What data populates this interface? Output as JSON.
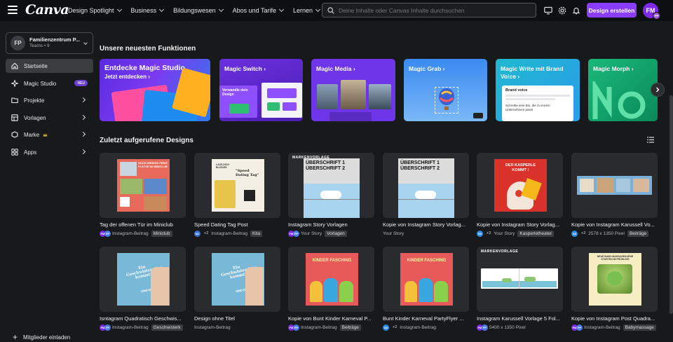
{
  "topbar": {
    "logo": "Canva",
    "nav": [
      "Design Spotlight",
      "Business",
      "Bildungswesen",
      "Abos und Tarife",
      "Lernen"
    ],
    "search_placeholder": "Deine Inhalte oder Canvas Inhalte durchsuchen",
    "create_label": "Design erstellen",
    "avatar_initials": "FM",
    "avatar_mini": "FP"
  },
  "sidebar": {
    "team_initials": "FP",
    "team_name": "Familienzentrum P...",
    "team_meta": "Teams • 9",
    "items": [
      {
        "label": "Startseite"
      },
      {
        "label": "Magic Studio",
        "badge": "NEU"
      },
      {
        "label": "Projekte"
      },
      {
        "label": "Vorlagen"
      },
      {
        "label": "Marke"
      },
      {
        "label": "Apps"
      }
    ],
    "invite_label": "Mitglieder einladen"
  },
  "features": {
    "heading": "Unsere neuesten Funktionen",
    "cards": [
      {
        "label": "Entdecke Magic Studio",
        "sub": "Jetzt entdecken"
      },
      {
        "label": "Magic Switch"
      },
      {
        "label": "Magic Media"
      },
      {
        "label": "Magic Grab"
      },
      {
        "label": "Magic Write mit Brand Voice"
      },
      {
        "label": "Magic Morph"
      }
    ],
    "switch_inner": "Verwandle dein Design",
    "brand_voice_title": "Brand voice",
    "brand_voice_text": "Schreibe eine Bio, die zu eurem Unternehmen passt"
  },
  "recent": {
    "heading": "Zuletzt aufgerufene Designs",
    "template_badge": "MARKENVORLAGE",
    "designs": [
      {
        "title": "Tag der offenen Tür im Miniclub",
        "people": [
          "FM",
          "FP"
        ],
        "extra": "",
        "type": "Instagram-Beitrag",
        "tag": "Miniclub"
      },
      {
        "title": "Speed Dating Tag Post",
        "people": [
          "MJ"
        ],
        "extra": "+2",
        "type": "Instagram-Beitrag",
        "tag": "Kita"
      },
      {
        "title": "Instagram Story Vorlagen",
        "people": [
          "FM",
          "FP"
        ],
        "extra": "",
        "type": "Your Story",
        "tag": "Vorlagen"
      },
      {
        "title": "Kopie von Instagram Story Vorlag...",
        "people": [],
        "extra": "",
        "type": "Your Story",
        "tag": ""
      },
      {
        "title": "Kopie von Instagram Story Vorlag...",
        "people": [
          "SS"
        ],
        "extra": "+2",
        "type": "Your Story",
        "tag": "Kasperletheater"
      },
      {
        "title": "Kopie von Instagram Karussell Vo...",
        "people": [
          "SS"
        ],
        "extra": "+2",
        "type": "2578 x 1350 Pixel",
        "tag": "Beiträge"
      },
      {
        "title": "Isntagram Quadratisch Geschwis...",
        "people": [
          "FM",
          "FP"
        ],
        "extra": "",
        "type": "Instagram-Beitrag",
        "tag": "Geschwisterk"
      },
      {
        "title": "Design ohne Titel",
        "people": [],
        "extra": "",
        "type": "Instagram-Beitrag",
        "tag": ""
      },
      {
        "title": "Kopie von Bunt Kinder Karneval P...",
        "people": [
          "FM",
          "FP"
        ],
        "extra": "",
        "type": "Instagram-Beitrag",
        "tag": "Beiträge"
      },
      {
        "title": "Bunt Kinder Karneval PartyFlyer ...",
        "people": [
          "SS"
        ],
        "extra": "+2",
        "type": "Instagram-Beitrag",
        "tag": ""
      },
      {
        "title": "Instagram Karussell Vorlage 5 Fol...",
        "people": [
          "FM",
          "FP"
        ],
        "extra": "",
        "type": "5400 x 1350 Pixel",
        "tag": ""
      },
      {
        "title": "Kopie von Instagram Post Quadra...",
        "people": [
          "FM",
          "FP"
        ],
        "extra": "",
        "type": "Instagram-Beitrag",
        "tag": "Babymassage"
      }
    ],
    "thumb_texts": {
      "miniclub": "NOCH WENIGE FREIE PLÄTZE IM MINICLUB",
      "speed": "\"Speed Dating Tag\"",
      "speed_top": "LASS DICH BLICKEN",
      "story": "ÜBERSCHRIFT 1 ÜBERSCHRIFT 2",
      "kasperle": "DER KASPERLE KOMMT !",
      "geschwister": "Ein Geschwisterchen kommt!",
      "geschwister_sub": "UND DANN?",
      "fasching": "KINDER FASCHING",
      "babymassage": "NEUE BABY-MASSAGEKURSE STARTEN IM FRÜHLING"
    }
  },
  "colors": {
    "accent": "#8b3dff",
    "topbar": "#0e0f11",
    "background": "#18191b",
    "card": "#2a2b2f",
    "person_fm": "#7d2ae8",
    "person_fp": "#4a7ae8",
    "person_ss": "#2a8be8",
    "person_mj": "#3a6fd8"
  }
}
